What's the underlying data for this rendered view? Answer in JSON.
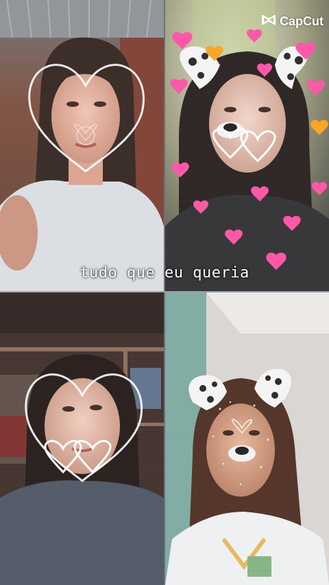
{
  "caption": "tudo que eu queria",
  "watermark": {
    "brand": "CapCut",
    "icon": "capcut-logo-icon"
  },
  "tiles": [
    {
      "name": "photo-top-left",
      "filter": "large-heart-outline",
      "heart_color": "#ffffff"
    },
    {
      "name": "photo-top-right",
      "filter": "dalmatian-ears-floating-hearts",
      "heart_color": "#ff4fa3"
    },
    {
      "name": "photo-bottom-left",
      "filter": "large-heart-outline-double-heart",
      "heart_color": "#ffffff"
    },
    {
      "name": "photo-bottom-right",
      "filter": "dalmatian-ears-sparkles",
      "heart_color": "#ffffff"
    }
  ]
}
